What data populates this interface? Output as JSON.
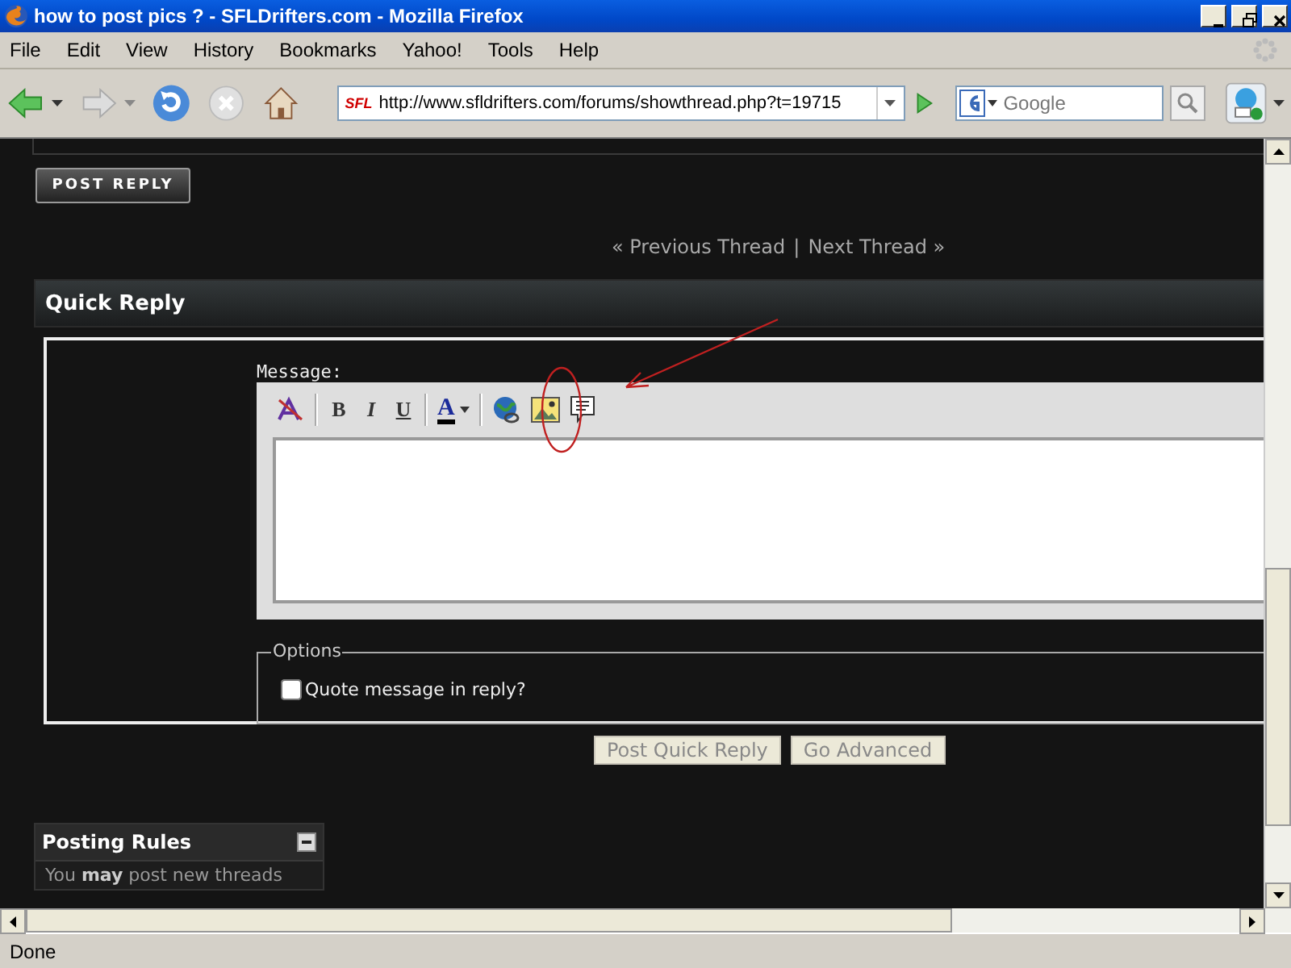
{
  "window": {
    "title": "how to post pics ? - SFLDrifters.com - Mozilla Firefox"
  },
  "menu": [
    "File",
    "Edit",
    "View",
    "History",
    "Bookmarks",
    "Yahoo!",
    "Tools",
    "Help"
  ],
  "toolbar": {
    "site_badge": "SFL",
    "url": "http://www.sfldrifters.com/forums/showthread.php?t=19715",
    "search_placeholder": "Google"
  },
  "page": {
    "post_reply_button": "POST REPLY",
    "thread_nav": {
      "previous": "« Previous Thread",
      "separator": "|",
      "next": "Next Thread »"
    },
    "quick_reply": {
      "title": "Quick Reply",
      "message_label": "Message:",
      "editor_tools": [
        {
          "kind": "remove-format"
        },
        {
          "kind": "bold",
          "label": "B"
        },
        {
          "kind": "italic",
          "label": "I"
        },
        {
          "kind": "underline",
          "label": "U"
        },
        {
          "kind": "color",
          "label": "A"
        },
        {
          "kind": "link"
        },
        {
          "kind": "image"
        },
        {
          "kind": "quote"
        }
      ],
      "options_legend": "Options",
      "quote_checkbox": {
        "label": "Quote message in reply?",
        "checked": false
      },
      "buttons": [
        "Post Quick Reply",
        "Go Advanced"
      ]
    },
    "posting_rules": {
      "title": "Posting Rules",
      "expanded": true,
      "text": "You **may** post new threads"
    }
  },
  "status_bar": "Done"
}
